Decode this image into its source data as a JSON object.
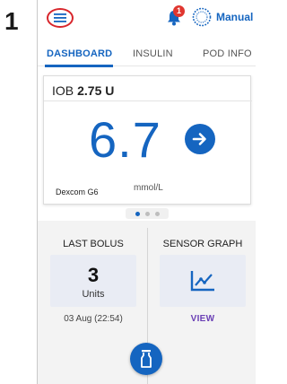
{
  "step_number": "1",
  "header": {
    "notification_count": "1",
    "mode_label": "Manual"
  },
  "tabs": [
    {
      "label": "DASHBOARD",
      "active": true
    },
    {
      "label": "INSULIN",
      "active": false
    },
    {
      "label": "POD INFO",
      "active": false
    }
  ],
  "glucose_card": {
    "iob_label": "IOB",
    "iob_value": "2.75 U",
    "glucose_value": "6.7",
    "unit": "mmol/L",
    "source": "Dexcom G6",
    "trend": "arrow-right-icon"
  },
  "pager": {
    "count": 3,
    "active_index": 0
  },
  "last_bolus": {
    "title": "LAST BOLUS",
    "amount": "3",
    "unit": "Units",
    "timestamp": "03 Aug (22:54)"
  },
  "sensor_graph": {
    "title": "SENSOR GRAPH",
    "link": "VIEW",
    "icon": "line-graph-icon"
  },
  "colors": {
    "accent": "#1565c0",
    "highlight_ring": "#d8262c",
    "badge": "#e0362f",
    "link": "#6a3fb5"
  }
}
